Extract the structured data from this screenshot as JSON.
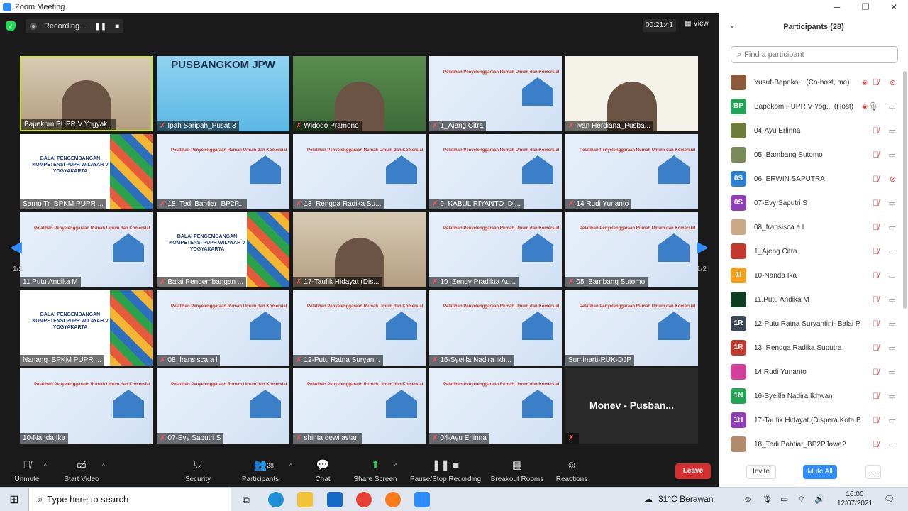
{
  "window": {
    "title": "Zoom Meeting",
    "minimize": "─",
    "maximize": "❐",
    "close": "✕"
  },
  "meeting": {
    "recording_label": "Recording...",
    "timer": "00:21:41",
    "view_label": "View",
    "page_indicator_left": "1/2",
    "page_indicator_right": "1/2"
  },
  "tiles": [
    {
      "name": "Bapekom PUPR V Yogyak...",
      "type": "room",
      "mic_off": false,
      "active": true
    },
    {
      "name": "Ipah Saripah_Pusat 3",
      "type": "jpw",
      "mic_off": true,
      "slide_text": "PUSBANGKOM JPW"
    },
    {
      "name": "Widodo Pramono",
      "type": "outdoor",
      "mic_off": true
    },
    {
      "name": "1_Ajeng Citra",
      "type": "banner",
      "mic_off": true
    },
    {
      "name": "Ivan Herdiana_Pusba...",
      "type": "ipw",
      "mic_off": true
    },
    {
      "name": "Sarno Tr_BPKM PUPR ...",
      "type": "bpsdm",
      "mic_off": false
    },
    {
      "name": "18_Tedi Bahtiar_BP2P...",
      "type": "banner",
      "mic_off": true
    },
    {
      "name": "13_Rengga Radika Su...",
      "type": "banner",
      "mic_off": true
    },
    {
      "name": "9_KABUL RIYANTO_DI...",
      "type": "banner",
      "mic_off": true
    },
    {
      "name": "14 Rudi Yunanto",
      "type": "banner",
      "mic_off": true
    },
    {
      "name": "11.Putu Andika M",
      "type": "banner",
      "mic_off": false
    },
    {
      "name": "Balai Pengembangan ...",
      "type": "bpsdm",
      "mic_off": true
    },
    {
      "name": "17-Taufik Hidayat (Dis...",
      "type": "room",
      "mic_off": true
    },
    {
      "name": "19_Zendy Pradikta Au...",
      "type": "banner",
      "mic_off": true
    },
    {
      "name": "05_Bambang Sutomo",
      "type": "banner",
      "mic_off": true
    },
    {
      "name": "Nanang_BPKM PUPR ...",
      "type": "bpsdm",
      "mic_off": false
    },
    {
      "name": "08_fransisca a l",
      "type": "banner",
      "mic_off": true
    },
    {
      "name": "12-Putu Ratna Suryan...",
      "type": "banner",
      "mic_off": true
    },
    {
      "name": "16-Syeilla Nadira Ikh...",
      "type": "banner",
      "mic_off": true
    },
    {
      "name": "Suminarti-RUK-DJP",
      "type": "banner",
      "mic_off": false
    },
    {
      "name": "10-Nanda Ika",
      "type": "banner",
      "mic_off": false
    },
    {
      "name": "07-Evy Saputri S",
      "type": "banner",
      "mic_off": true
    },
    {
      "name": "shinta dewi astari",
      "type": "banner",
      "mic_off": true
    },
    {
      "name": "04-Ayu Erlinna",
      "type": "banner",
      "mic_off": true
    },
    {
      "name": "",
      "type": "dark",
      "mic_off": true,
      "center_text": "Monev - Pusban..."
    }
  ],
  "slide": {
    "title": "Pelatihan Penyelenggaraan Rumah Umum dan Komersial",
    "bpsdm_text": "BALAI PENGEMBANGAN KOMPETENSI PUPR WILAYAH V YOGYAKARTA"
  },
  "toolbar": {
    "unmute": "Unmute",
    "start_video": "Start Video",
    "security": "Security",
    "participants": "Participants",
    "participants_count": "28",
    "chat": "Chat",
    "share_screen": "Share Screen",
    "pause_stop_recording": "Pause/Stop Recording",
    "breakout_rooms": "Breakout Rooms",
    "reactions": "Reactions",
    "leave": "Leave"
  },
  "panel": {
    "title": "Participants (28)",
    "search_placeholder": "Find a participant",
    "participants": [
      {
        "initials": "",
        "name": "Yusuf-Bapeko...  (Co-host, me)",
        "color": "#8a5a3a",
        "mic_off": true,
        "cam_off": true,
        "recording": true
      },
      {
        "initials": "BP",
        "name": "Bapekom PUPR V Yog...  (Host)",
        "color": "#23a455",
        "mic_off": false,
        "cam_off": false,
        "recording": true
      },
      {
        "initials": "",
        "name": "04-Ayu Erlinna",
        "color": "#6f7d3a",
        "mic_off": true,
        "cam_off": false,
        "recording": false
      },
      {
        "initials": "",
        "name": "05_Bambang Sutomo",
        "color": "#7a8a5a",
        "mic_off": true,
        "cam_off": false,
        "recording": false
      },
      {
        "initials": "0S",
        "name": "06_ERWIN SAPUTRA",
        "color": "#2d7fd1",
        "mic_off": true,
        "cam_off": true,
        "recording": false
      },
      {
        "initials": "0S",
        "name": "07-Evy Saputri S",
        "color": "#8e3fb8",
        "mic_off": true,
        "cam_off": false,
        "recording": false
      },
      {
        "initials": "",
        "name": "08_fransisca a l",
        "color": "#c9a98a",
        "mic_off": true,
        "cam_off": false,
        "recording": false
      },
      {
        "initials": "",
        "name": "1_Ajeng Citra",
        "color": "#c0392b",
        "mic_off": true,
        "cam_off": false,
        "recording": false
      },
      {
        "initials": "1I",
        "name": "10-Nanda Ika",
        "color": "#f0a01c",
        "mic_off": true,
        "cam_off": false,
        "recording": false
      },
      {
        "initials": "",
        "name": "11.Putu Andika M",
        "color": "#0f3d1f",
        "mic_off": true,
        "cam_off": false,
        "recording": false
      },
      {
        "initials": "1R",
        "name": "12-Putu Ratna Suryantini- Balai P...",
        "color": "#3d4756",
        "mic_off": true,
        "cam_off": false,
        "recording": false
      },
      {
        "initials": "1R",
        "name": "13_Rengga Radika Suputra",
        "color": "#c0392b",
        "mic_off": true,
        "cam_off": false,
        "recording": false
      },
      {
        "initials": "",
        "name": "14 Rudi Yunanto",
        "color": "#d13f9a",
        "mic_off": true,
        "cam_off": false,
        "recording": false
      },
      {
        "initials": "1N",
        "name": "16-Syeilla Nadira Ikhwan",
        "color": "#23a455",
        "mic_off": true,
        "cam_off": false,
        "recording": false
      },
      {
        "initials": "1H",
        "name": "17-Taufik Hidayat (Dispera Kota B...",
        "color": "#8e3fb8",
        "mic_off": true,
        "cam_off": false,
        "recording": false
      },
      {
        "initials": "",
        "name": "18_Tedi Bahtiar_BP2PJawa2",
        "color": "#b08c6a",
        "mic_off": true,
        "cam_off": false,
        "recording": false
      }
    ],
    "invite": "Invite",
    "mute_all": "Mute All",
    "more": "..."
  },
  "taskbar": {
    "search_placeholder": "Type here to search",
    "weather": "31°C  Berawan",
    "time": "16:00",
    "date": "12/07/2021"
  }
}
